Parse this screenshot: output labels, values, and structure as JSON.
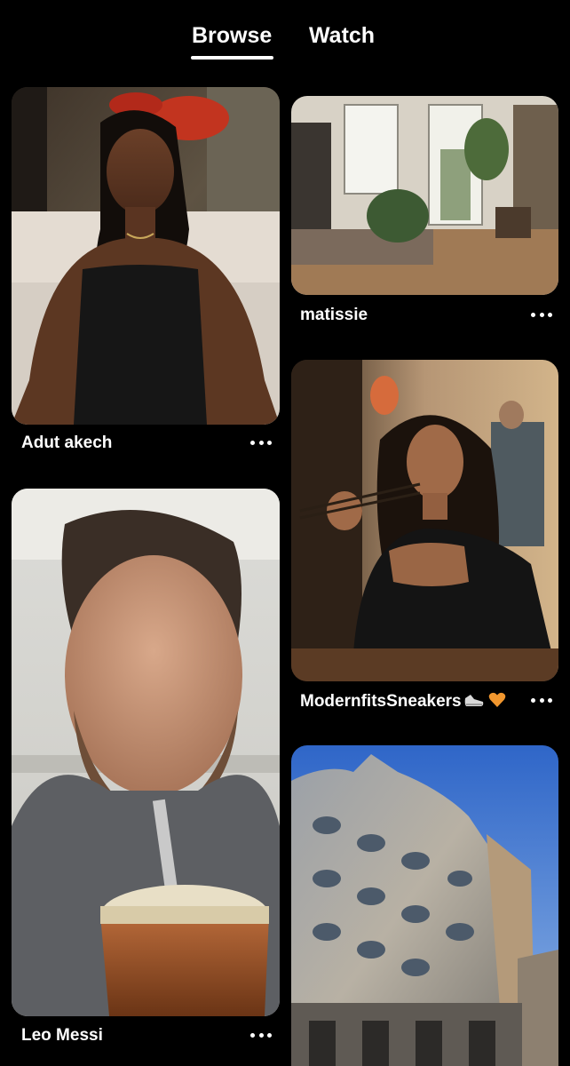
{
  "tabs": {
    "browse": "Browse",
    "watch": "Watch",
    "active": "Browse"
  },
  "pins": [
    {
      "title": "Adut akech"
    },
    {
      "title": "matissie"
    },
    {
      "title": "Leo Messi"
    },
    {
      "title": "ModernfitsSneakers",
      "emojis": [
        "sneaker-icon",
        "orange-heart-icon"
      ]
    }
  ],
  "colors": {
    "background": "#000000",
    "text": "#ffffff",
    "heart": "#f0962e"
  }
}
